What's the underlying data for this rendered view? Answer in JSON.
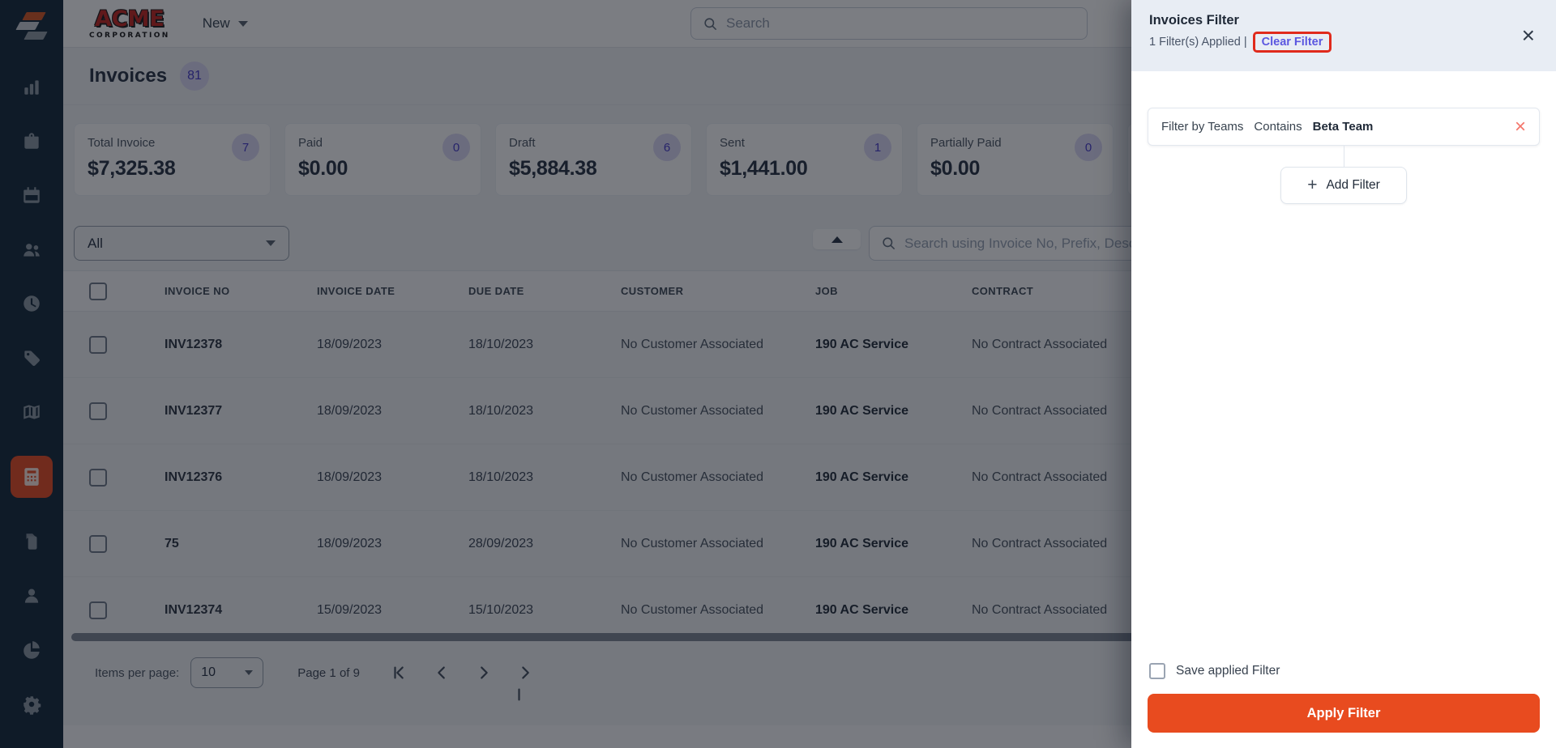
{
  "topbar": {
    "brand_line1": "ACME",
    "brand_line2": "CORPORATION",
    "new_menu_label": "New",
    "search_placeholder": "Search"
  },
  "sidebar": {
    "items": [
      {
        "icon": "bar-chart-icon"
      },
      {
        "icon": "briefcase-icon"
      },
      {
        "icon": "calendar-icon"
      },
      {
        "icon": "users-icon"
      },
      {
        "icon": "clock-icon"
      },
      {
        "icon": "tag-icon"
      },
      {
        "icon": "map-icon"
      },
      {
        "icon": "invoice-calculator-icon",
        "active": true
      },
      {
        "icon": "documents-icon"
      },
      {
        "icon": "person-icon"
      },
      {
        "icon": "pie-chart-icon"
      },
      {
        "icon": "gear-icon"
      }
    ]
  },
  "page": {
    "title": "Invoices",
    "count_badge": "81"
  },
  "summary_cards": [
    {
      "label": "Total Invoice",
      "value": "$7,325.38",
      "count": "7"
    },
    {
      "label": "Paid",
      "value": "$0.00",
      "count": "0"
    },
    {
      "label": "Draft",
      "value": "$5,884.38",
      "count": "6"
    },
    {
      "label": "Sent",
      "value": "$1,441.00",
      "count": "1"
    },
    {
      "label": "Partially Paid",
      "value": "$0.00",
      "count": "0"
    }
  ],
  "toolbar": {
    "status_filter_value": "All",
    "search_placeholder": "Search using Invoice No, Prefix, Desc"
  },
  "table": {
    "columns": [
      "INVOICE NO",
      "INVOICE DATE",
      "DUE DATE",
      "CUSTOMER",
      "JOB",
      "CONTRACT"
    ],
    "rows": [
      {
        "invoice_no": "INV12378",
        "invoice_date": "18/09/2023",
        "due_date": "18/10/2023",
        "customer": "No Customer Associated",
        "job": "190 AC Service",
        "contract": "No Contract Associated"
      },
      {
        "invoice_no": "INV12377",
        "invoice_date": "18/09/2023",
        "due_date": "18/10/2023",
        "customer": "No Customer Associated",
        "job": "190 AC Service",
        "contract": "No Contract Associated"
      },
      {
        "invoice_no": "INV12376",
        "invoice_date": "18/09/2023",
        "due_date": "18/10/2023",
        "customer": "No Customer Associated",
        "job": "190 AC Service",
        "contract": "No Contract Associated"
      },
      {
        "invoice_no": "75",
        "invoice_date": "18/09/2023",
        "due_date": "28/09/2023",
        "customer": "No Customer Associated",
        "job": "190 AC Service",
        "contract": "No Contract Associated"
      },
      {
        "invoice_no": "INV12374",
        "invoice_date": "15/09/2023",
        "due_date": "15/10/2023",
        "customer": "No Customer Associated",
        "job": "190 AC Service",
        "contract": "No Contract Associated"
      }
    ]
  },
  "pagination": {
    "items_per_page_label": "Items per page:",
    "items_per_page_value": "10",
    "page_info": "Page 1 of 9"
  },
  "filter_panel": {
    "title": "Invoices Filter",
    "applied_text": "1 Filter(s) Applied |",
    "clear_filter_label": "Clear Filter",
    "filter_row": {
      "field": "Filter by Teams",
      "operator": "Contains",
      "value": "Beta Team"
    },
    "add_filter_plus": "+",
    "add_filter_label": "Add Filter",
    "save_filter_label": "Save applied Filter",
    "apply_button_label": "Apply Filter",
    "close_icon": "×",
    "remove_filter_icon": "×"
  },
  "colors": {
    "accent_orange": "#E84B1F",
    "link_purple": "#5B57E0",
    "annotation_red": "#E02A1C",
    "sidebar_bg": "#112638",
    "sidebar_active": "#E8491F",
    "badge_bg": "#DCD9F6",
    "badge_text": "#4338CA",
    "drawer_header_bg": "#E8EDF4"
  }
}
